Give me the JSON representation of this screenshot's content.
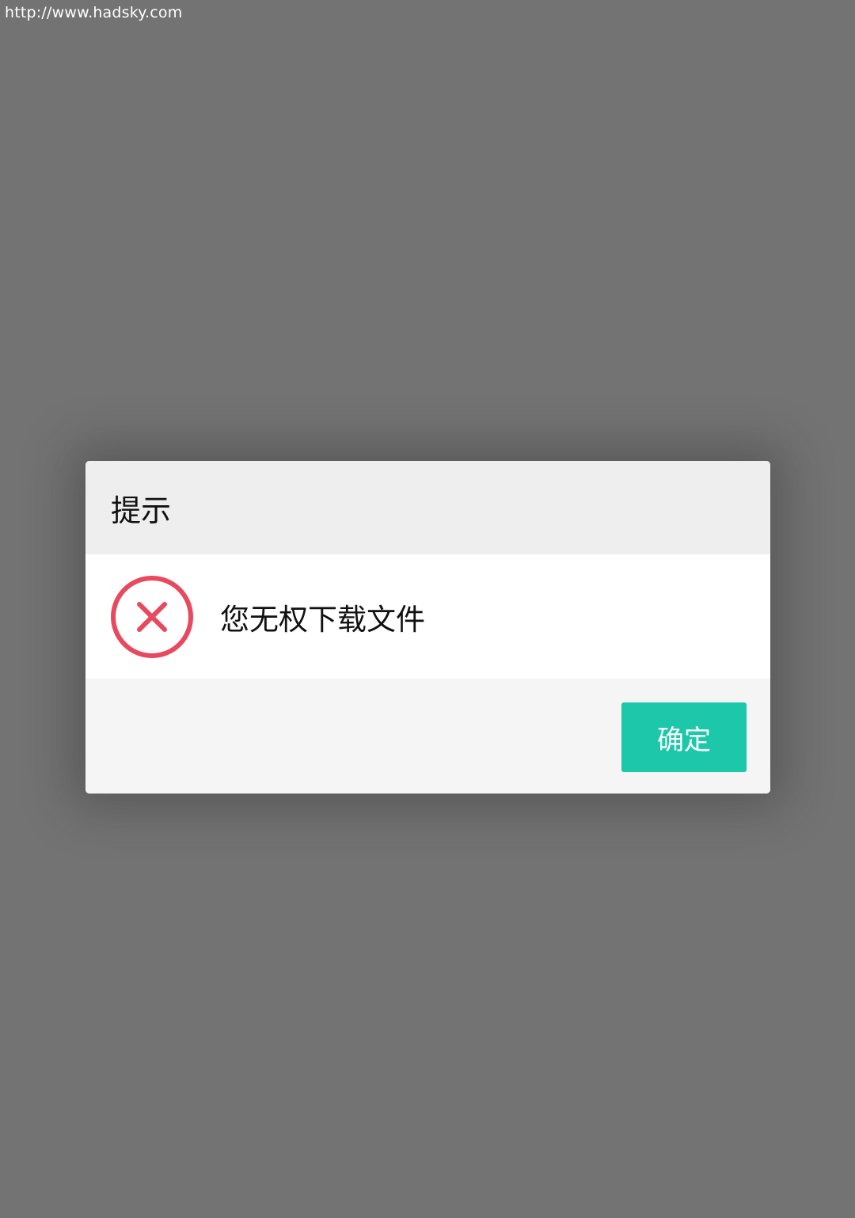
{
  "url": "http://www.hadsky.com",
  "dialog": {
    "title": "提示",
    "message": "您无权下载文件",
    "icon": "error-circle-x-icon",
    "confirm_label": "确定"
  },
  "colors": {
    "overlay": "#737373",
    "accent": "#1dc8aa",
    "error": "#e8495f"
  }
}
